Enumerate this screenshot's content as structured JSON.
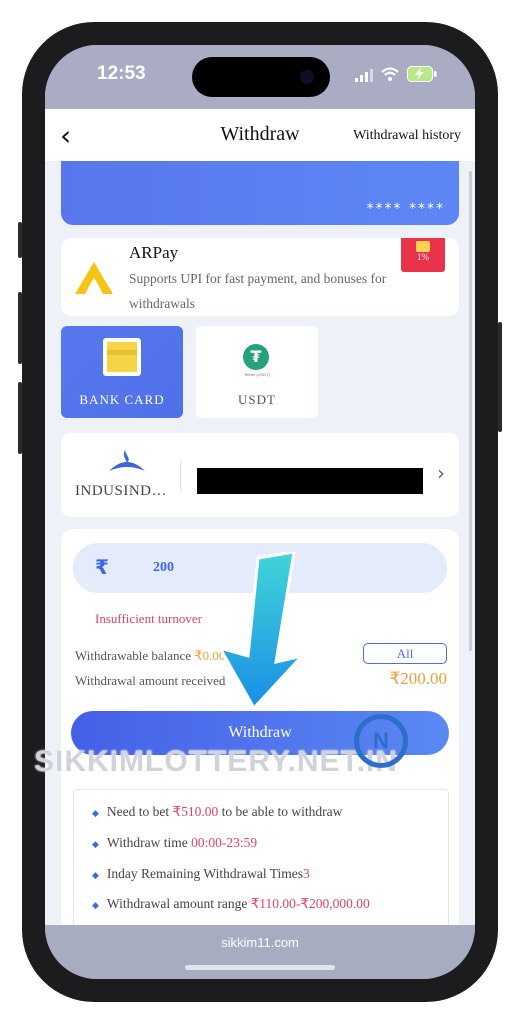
{
  "status_bar": {
    "time": "12:53"
  },
  "nav": {
    "back_icon": "chevron-left-icon",
    "title": "Withdraw",
    "history_label": "Withdrawal history"
  },
  "card": {
    "masked_number": "**** ****"
  },
  "arpay": {
    "title": "ARPay",
    "description": "Supports UPI for fast payment, and bonuses for withdrawals",
    "badge": "1%"
  },
  "methods": [
    {
      "label": "BANK CARD",
      "active": true
    },
    {
      "label": "USDT",
      "active": false,
      "icon_text": "Tether (USDT)"
    }
  ],
  "bank": {
    "name": "INDUSIND…"
  },
  "form": {
    "currency_symbol": "₹",
    "amount": "200",
    "error": "Insufficient turnover",
    "withdrawable_label": "Withdrawable balance",
    "withdrawable_value": "₹0.00",
    "all_label": "All",
    "received_label": "Withdrawal amount received",
    "received_value": "₹200.00",
    "submit_label": "Withdraw"
  },
  "watermark": {
    "text": "SIKKIMLOTTERY.NET.IN",
    "logo_letter": "N"
  },
  "rules": {
    "r1_pre": "Need to bet ",
    "r1_amount": "₹510.00",
    "r1_post": " to be able to withdraw",
    "r2_pre": "Withdraw time ",
    "r2_value": "00:00-23:59",
    "r3_pre": "Inday Remaining Withdrawal Times",
    "r3_value": "3",
    "r4_pre": "Withdrawal amount range ",
    "r4_value": "₹110.00-₹200,000.00"
  },
  "browser": {
    "url": "sikkim11.com"
  },
  "colors": {
    "primary": "#4e6fe6",
    "accent_orange": "#e8a23a",
    "error_red": "#e0445a",
    "usdt_green": "#27a17c"
  }
}
